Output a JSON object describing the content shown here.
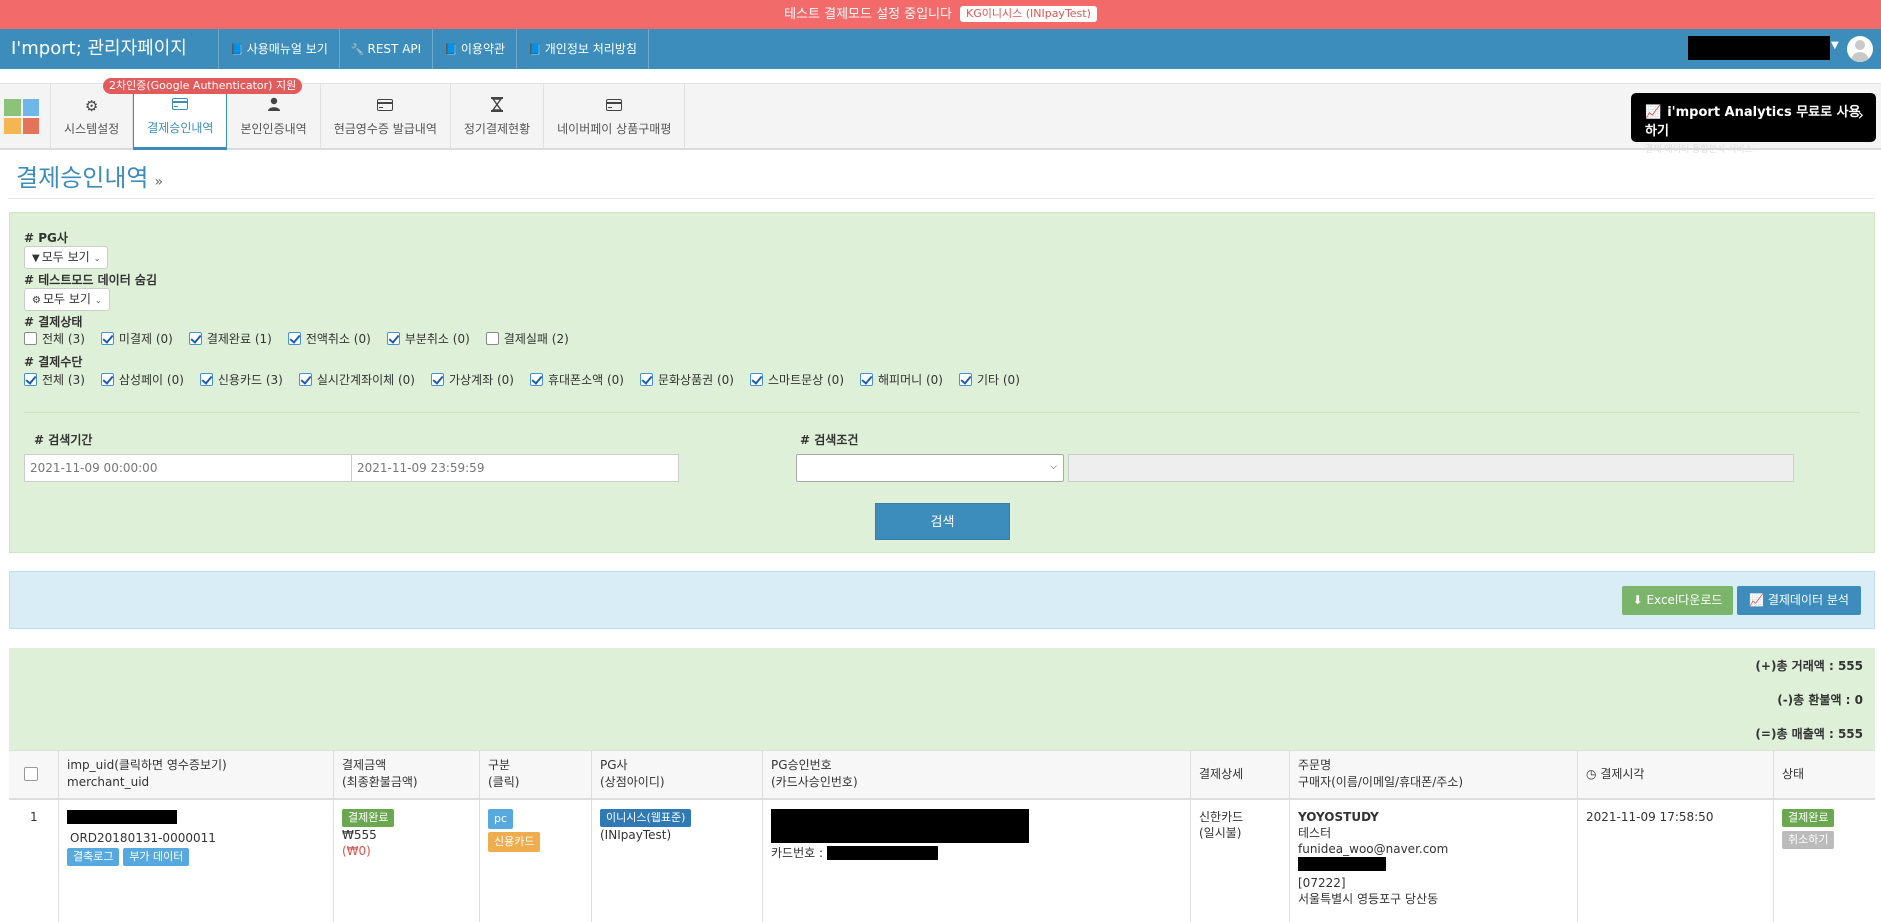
{
  "banner": {
    "text": "테스트 결제모드 설정 중입니다",
    "pg_badge": "KG이니시스 (INIpayTest)"
  },
  "header": {
    "brand": "I'mport; 관리자페이지",
    "nav": [
      {
        "label": "사용매뉴얼 보기",
        "icon": "book-icon"
      },
      {
        "label": "REST API",
        "icon": "wrench-icon"
      },
      {
        "label": "이용약관",
        "icon": "book-icon"
      },
      {
        "label": "개인정보 처리방침",
        "icon": "book-icon"
      }
    ]
  },
  "menu": {
    "twofa_badge": "2차인증(Google Authenticator) 지원",
    "tabs": [
      {
        "label": "시스템설정",
        "icon": "gear-icon"
      },
      {
        "label": "결제승인내역",
        "icon": "credit-card-icon",
        "active": true
      },
      {
        "label": "본인인증내역",
        "icon": "user-icon"
      },
      {
        "label": "현금영수증 발급내역",
        "icon": "credit-card-icon"
      },
      {
        "label": "정기결제현황",
        "icon": "hourglass-icon"
      },
      {
        "label": "네이버페이 상품구매평",
        "icon": "credit-card-icon"
      }
    ],
    "analytics": {
      "title": "i'mport Analytics 무료로 사용하기",
      "subtitle": "결제 데이터 통합분석 서비스"
    }
  },
  "page": {
    "title": "결제승인내역",
    "title_suffix": "»"
  },
  "filters": {
    "pg_label": "# PG사",
    "pg_dropdown": "모두 보기",
    "testmode_label": "# 테스트모드 데이터 숨김",
    "testmode_dropdown": "모두 보기",
    "status_label": "# 결제상태",
    "status_options": [
      {
        "label": "전체 (3)",
        "checked": false
      },
      {
        "label": "미결제 (0)",
        "checked": true
      },
      {
        "label": "결제완료 (1)",
        "checked": true
      },
      {
        "label": "전액취소 (0)",
        "checked": true
      },
      {
        "label": "부분취소 (0)",
        "checked": true
      },
      {
        "label": "결제실패 (2)",
        "checked": false
      }
    ],
    "method_label": "# 결제수단",
    "method_options": [
      {
        "label": "전체 (3)",
        "checked": true
      },
      {
        "label": "삼성페이 (0)",
        "checked": true
      },
      {
        "label": "신용카드 (3)",
        "checked": true
      },
      {
        "label": "실시간계좌이체 (0)",
        "checked": true
      },
      {
        "label": "가상계좌 (0)",
        "checked": true
      },
      {
        "label": "휴대폰소액 (0)",
        "checked": true
      },
      {
        "label": "문화상품권 (0)",
        "checked": true
      },
      {
        "label": "스마트문상 (0)",
        "checked": true
      },
      {
        "label": "해피머니 (0)",
        "checked": true
      },
      {
        "label": "기타 (0)",
        "checked": true
      }
    ],
    "period_label": "# 검색기간",
    "period_start": "2021-11-09 00:00:00",
    "period_end": "2021-11-09 23:59:59",
    "condition_label": "# 검색조건",
    "condition_selected": "",
    "condition_value": "",
    "search_button": "검색"
  },
  "actions": {
    "excel": "Excel다운로드",
    "analysis": "결제데이터 분석"
  },
  "totals": {
    "gross": "(+)총 거래액 : 555",
    "refund": "(-)총 환불액 : 0",
    "net": "(=)총 매출액 : 555"
  },
  "table": {
    "headers": {
      "uid": [
        "imp_uid(클릭하면 영수증보기)",
        "merchant_uid"
      ],
      "amount": [
        "결제금액",
        "(최종환불금액)"
      ],
      "kind": [
        "구분",
        "(클릭)"
      ],
      "pg": [
        "PG사",
        "(상점아이디)"
      ],
      "approval": [
        "PG승인번호",
        "(카드사승인번호)"
      ],
      "detail": [
        "결제상세"
      ],
      "order": [
        "주문명",
        "구매자(이름/이메일/휴대폰/주소)"
      ],
      "time": [
        "결제시각"
      ],
      "status": [
        "상태"
      ]
    },
    "rows": [
      {
        "index": "1",
        "merchant_uid": "ORD20180131-0000011",
        "btn_log": "결축로그",
        "btn_extra": "부가 데이터",
        "status_label": "결제완료",
        "amount": "₩555",
        "refund": "(₩0)",
        "channel": "pc",
        "method": "신용카드",
        "pg_name": "이니시스(웹표준)",
        "pg_mid": "(INIpayTest)",
        "card_no_label": "카드번호 :",
        "detail_line1": "신한카드",
        "detail_line2": "(일시불)",
        "order_name": "YOYOSTUDY",
        "buyer_name": "테스터",
        "buyer_email": "funidea_woo@naver.com",
        "buyer_zip": "[07222]",
        "buyer_addr": "서울특별시 영등포구 당산동",
        "paid_at": "2021-11-09 17:58:50",
        "status_badge": "결제완료",
        "cancel_button": "취소하기"
      }
    ]
  },
  "colors": {
    "banner": "#f26a6a",
    "header": "#3c8dbc",
    "filter_panel": "#dff0d8",
    "action_bar": "#d9edf7",
    "accent": "#3c8dbc"
  }
}
